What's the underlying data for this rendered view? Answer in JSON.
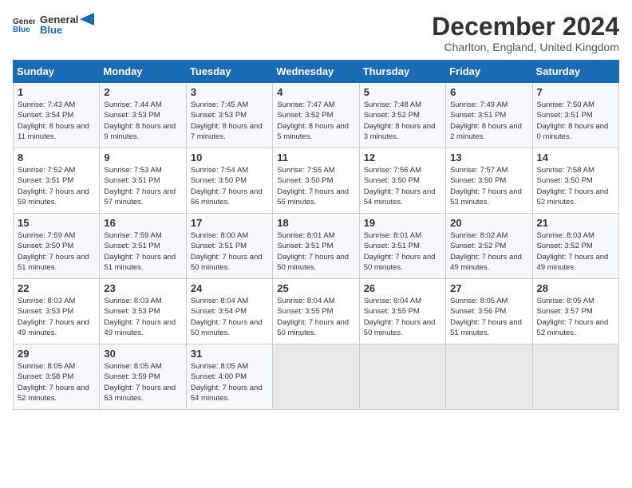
{
  "logo": {
    "general": "General",
    "blue": "Blue"
  },
  "header": {
    "month": "December 2024",
    "location": "Charlton, England, United Kingdom"
  },
  "columns": [
    "Sunday",
    "Monday",
    "Tuesday",
    "Wednesday",
    "Thursday",
    "Friday",
    "Saturday"
  ],
  "weeks": [
    [
      {
        "day": "1",
        "sunrise": "Sunrise: 7:43 AM",
        "sunset": "Sunset: 3:54 PM",
        "daylight": "Daylight: 8 hours and 11 minutes."
      },
      {
        "day": "2",
        "sunrise": "Sunrise: 7:44 AM",
        "sunset": "Sunset: 3:53 PM",
        "daylight": "Daylight: 8 hours and 9 minutes."
      },
      {
        "day": "3",
        "sunrise": "Sunrise: 7:45 AM",
        "sunset": "Sunset: 3:53 PM",
        "daylight": "Daylight: 8 hours and 7 minutes."
      },
      {
        "day": "4",
        "sunrise": "Sunrise: 7:47 AM",
        "sunset": "Sunset: 3:52 PM",
        "daylight": "Daylight: 8 hours and 5 minutes."
      },
      {
        "day": "5",
        "sunrise": "Sunrise: 7:48 AM",
        "sunset": "Sunset: 3:52 PM",
        "daylight": "Daylight: 8 hours and 3 minutes."
      },
      {
        "day": "6",
        "sunrise": "Sunrise: 7:49 AM",
        "sunset": "Sunset: 3:51 PM",
        "daylight": "Daylight: 8 hours and 2 minutes."
      },
      {
        "day": "7",
        "sunrise": "Sunrise: 7:50 AM",
        "sunset": "Sunset: 3:51 PM",
        "daylight": "Daylight: 8 hours and 0 minutes."
      }
    ],
    [
      {
        "day": "8",
        "sunrise": "Sunrise: 7:52 AM",
        "sunset": "Sunset: 3:51 PM",
        "daylight": "Daylight: 7 hours and 59 minutes."
      },
      {
        "day": "9",
        "sunrise": "Sunrise: 7:53 AM",
        "sunset": "Sunset: 3:51 PM",
        "daylight": "Daylight: 7 hours and 57 minutes."
      },
      {
        "day": "10",
        "sunrise": "Sunrise: 7:54 AM",
        "sunset": "Sunset: 3:50 PM",
        "daylight": "Daylight: 7 hours and 56 minutes."
      },
      {
        "day": "11",
        "sunrise": "Sunrise: 7:55 AM",
        "sunset": "Sunset: 3:50 PM",
        "daylight": "Daylight: 7 hours and 55 minutes."
      },
      {
        "day": "12",
        "sunrise": "Sunrise: 7:56 AM",
        "sunset": "Sunset: 3:50 PM",
        "daylight": "Daylight: 7 hours and 54 minutes."
      },
      {
        "day": "13",
        "sunrise": "Sunrise: 7:57 AM",
        "sunset": "Sunset: 3:50 PM",
        "daylight": "Daylight: 7 hours and 53 minutes."
      },
      {
        "day": "14",
        "sunrise": "Sunrise: 7:58 AM",
        "sunset": "Sunset: 3:50 PM",
        "daylight": "Daylight: 7 hours and 52 minutes."
      }
    ],
    [
      {
        "day": "15",
        "sunrise": "Sunrise: 7:59 AM",
        "sunset": "Sunset: 3:50 PM",
        "daylight": "Daylight: 7 hours and 51 minutes."
      },
      {
        "day": "16",
        "sunrise": "Sunrise: 7:59 AM",
        "sunset": "Sunset: 3:51 PM",
        "daylight": "Daylight: 7 hours and 51 minutes."
      },
      {
        "day": "17",
        "sunrise": "Sunrise: 8:00 AM",
        "sunset": "Sunset: 3:51 PM",
        "daylight": "Daylight: 7 hours and 50 minutes."
      },
      {
        "day": "18",
        "sunrise": "Sunrise: 8:01 AM",
        "sunset": "Sunset: 3:51 PM",
        "daylight": "Daylight: 7 hours and 50 minutes."
      },
      {
        "day": "19",
        "sunrise": "Sunrise: 8:01 AM",
        "sunset": "Sunset: 3:51 PM",
        "daylight": "Daylight: 7 hours and 50 minutes."
      },
      {
        "day": "20",
        "sunrise": "Sunrise: 8:02 AM",
        "sunset": "Sunset: 3:52 PM",
        "daylight": "Daylight: 7 hours and 49 minutes."
      },
      {
        "day": "21",
        "sunrise": "Sunrise: 8:03 AM",
        "sunset": "Sunset: 3:52 PM",
        "daylight": "Daylight: 7 hours and 49 minutes."
      }
    ],
    [
      {
        "day": "22",
        "sunrise": "Sunrise: 8:03 AM",
        "sunset": "Sunset: 3:53 PM",
        "daylight": "Daylight: 7 hours and 49 minutes."
      },
      {
        "day": "23",
        "sunrise": "Sunrise: 8:03 AM",
        "sunset": "Sunset: 3:53 PM",
        "daylight": "Daylight: 7 hours and 49 minutes."
      },
      {
        "day": "24",
        "sunrise": "Sunrise: 8:04 AM",
        "sunset": "Sunset: 3:54 PM",
        "daylight": "Daylight: 7 hours and 50 minutes."
      },
      {
        "day": "25",
        "sunrise": "Sunrise: 8:04 AM",
        "sunset": "Sunset: 3:55 PM",
        "daylight": "Daylight: 7 hours and 50 minutes."
      },
      {
        "day": "26",
        "sunrise": "Sunrise: 8:04 AM",
        "sunset": "Sunset: 3:55 PM",
        "daylight": "Daylight: 7 hours and 50 minutes."
      },
      {
        "day": "27",
        "sunrise": "Sunrise: 8:05 AM",
        "sunset": "Sunset: 3:56 PM",
        "daylight": "Daylight: 7 hours and 51 minutes."
      },
      {
        "day": "28",
        "sunrise": "Sunrise: 8:05 AM",
        "sunset": "Sunset: 3:57 PM",
        "daylight": "Daylight: 7 hours and 52 minutes."
      }
    ],
    [
      {
        "day": "29",
        "sunrise": "Sunrise: 8:05 AM",
        "sunset": "Sunset: 3:58 PM",
        "daylight": "Daylight: 7 hours and 52 minutes."
      },
      {
        "day": "30",
        "sunrise": "Sunrise: 8:05 AM",
        "sunset": "Sunset: 3:59 PM",
        "daylight": "Daylight: 7 hours and 53 minutes."
      },
      {
        "day": "31",
        "sunrise": "Sunrise: 8:05 AM",
        "sunset": "Sunset: 4:00 PM",
        "daylight": "Daylight: 7 hours and 54 minutes."
      },
      null,
      null,
      null,
      null
    ]
  ]
}
